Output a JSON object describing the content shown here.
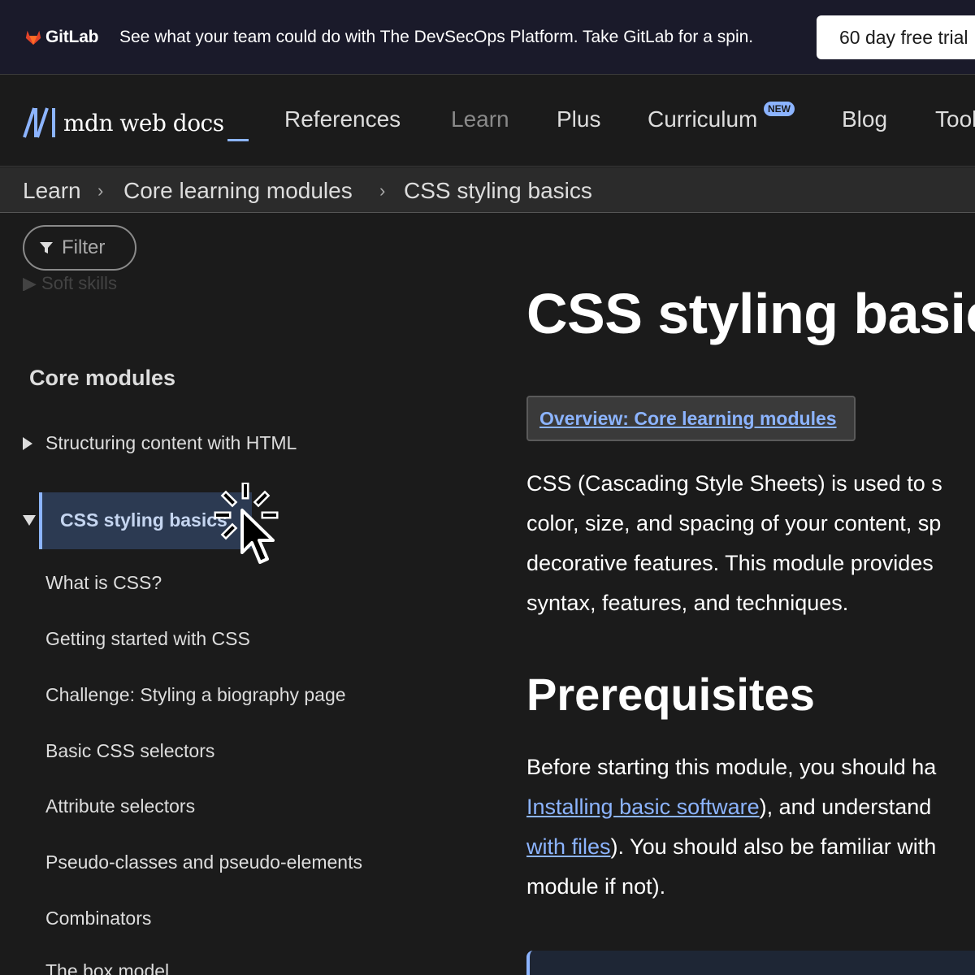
{
  "banner": {
    "logo_text": "GitLab",
    "message": "See what your team could do with The DevSecOps Platform. Take GitLab for a spin.",
    "cta": "60 day free trial"
  },
  "nav": {
    "logo_text": "mdn web docs",
    "items": [
      "References",
      "Learn",
      "Plus",
      "Curriculum",
      "Blog",
      "Tools"
    ],
    "new_badge": "NEW"
  },
  "breadcrumbs": [
    "Learn",
    "Core learning modules",
    "CSS styling basics"
  ],
  "sidebar": {
    "filter_label": "Filter",
    "faded_item": "Soft skills",
    "section_title": "Core modules",
    "collapsed_item": "Structuring content with HTML",
    "active_item": "CSS styling basics",
    "children": [
      "What is CSS?",
      "Getting started with CSS",
      "Challenge: Styling a biography page",
      "Basic CSS selectors",
      "Attribute selectors",
      "Pseudo-classes and pseudo-elements",
      "Combinators",
      "The box model"
    ]
  },
  "main": {
    "title": "CSS styling basics",
    "overview_link": "Overview: Core learning modules",
    "intro_lines": [
      "CSS (Cascading Style Sheets) is used to s",
      "color, size, and spacing of your content, sp",
      "decorative features. This module provides",
      "syntax, features, and techniques."
    ],
    "prereq_heading": "Prerequisites",
    "prereq_line1": "Before starting this module, you should ha",
    "prereq_link1": "Installing basic software",
    "prereq_line2_rest": "), and understand",
    "prereq_link2": "with files",
    "prereq_line3_rest": "). You should also be familiar with",
    "prereq_line4": "module if not)."
  },
  "colors": {
    "accent": "#8cb4ff",
    "background": "#1b1b1b",
    "banner_bg": "#1a1a2a",
    "active_bg": "#2c3a52"
  }
}
